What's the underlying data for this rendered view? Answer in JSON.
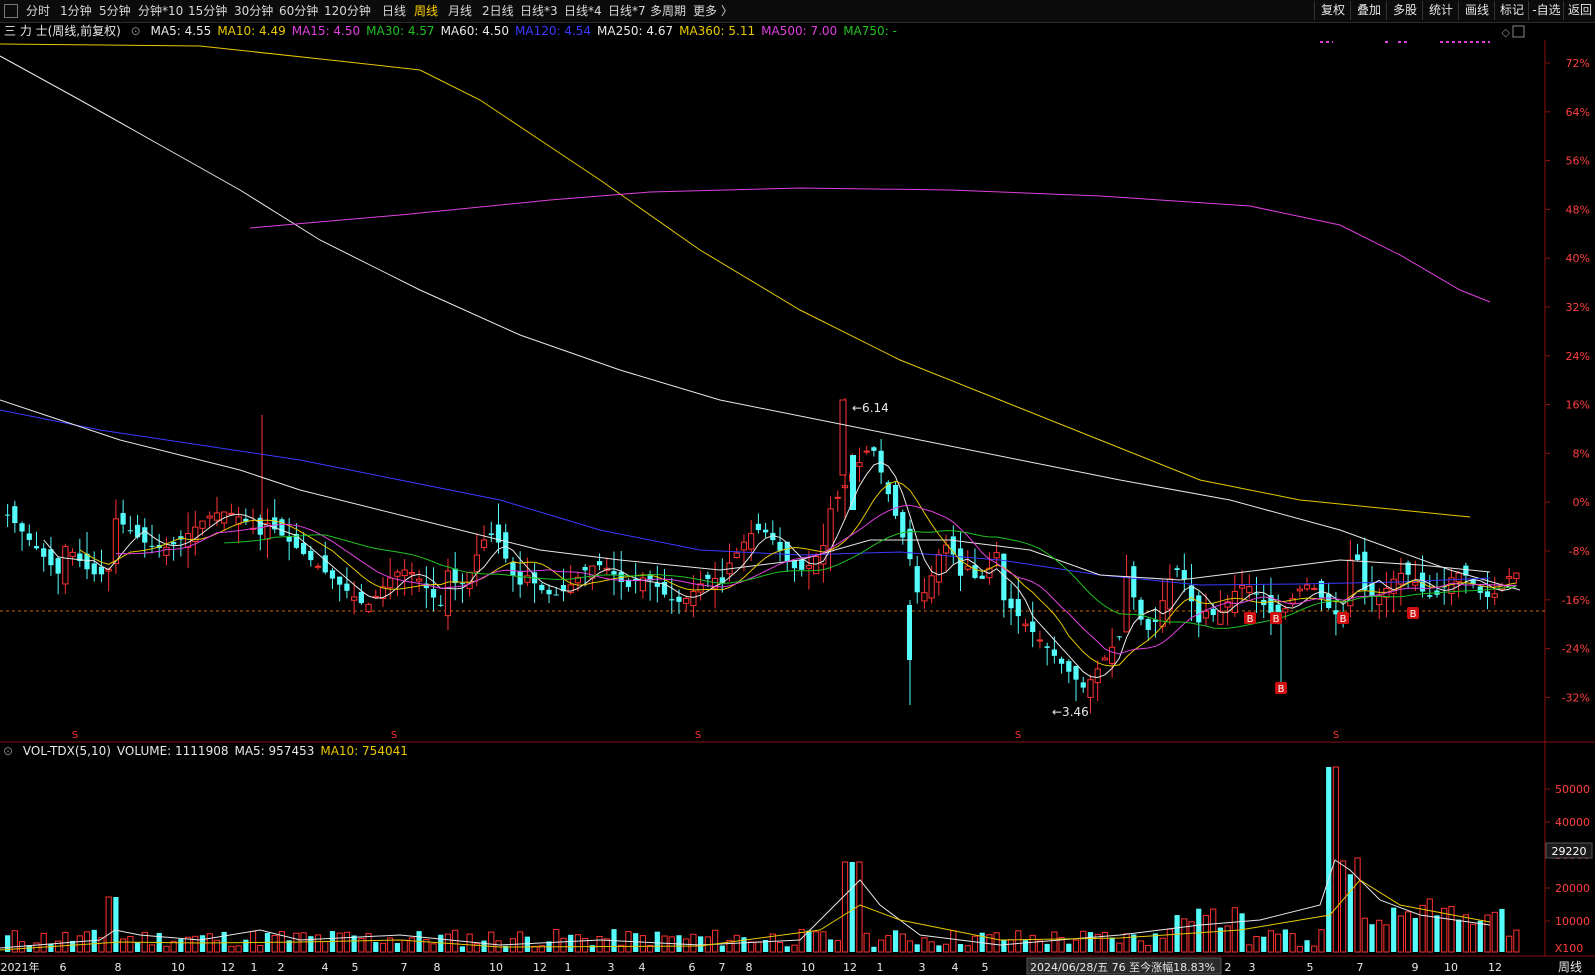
{
  "toolbar": {
    "periods": [
      "分时",
      "1分钟",
      "5分钟",
      "分钟*10",
      "15分钟",
      "30分钟",
      "60分钟",
      "120分钟",
      "日线",
      "周线",
      "月线",
      "2日线",
      "日线*3",
      "日线*4",
      "日线*7",
      "多周期",
      "更多 〉"
    ],
    "active": "周线",
    "right_buttons": [
      "复权",
      "叠加",
      "多股",
      "统计",
      "画线",
      "标记",
      "-自选",
      "返回"
    ]
  },
  "legend": {
    "title": "三 力 士(周线,前复权)",
    "items": [
      {
        "text": "MA5: 4.55",
        "color": "#e8e8e8"
      },
      {
        "text": "MA10: 4.49",
        "color": "#e8c800"
      },
      {
        "text": "MA15: 4.50",
        "color": "#e040e0"
      },
      {
        "text": "MA30: 4.57",
        "color": "#20c020"
      },
      {
        "text": "MA60: 4.50",
        "color": "#e8e8e8"
      },
      {
        "text": "MA120: 4.54",
        "color": "#3a3aff"
      },
      {
        "text": "MA250: 4.67",
        "color": "#e8e8e8"
      },
      {
        "text": "MA360: 5.11",
        "color": "#e8c800"
      },
      {
        "text": "MA500: 7.00",
        "color": "#e040e0"
      },
      {
        "text": "MA750: -",
        "color": "#20c020"
      }
    ]
  },
  "vol_legend": {
    "items": [
      {
        "text": "VOL-TDX(5,10)",
        "color": "#e8e8e8"
      },
      {
        "text": "VOLUME: 1111908",
        "color": "#e8e8e8"
      },
      {
        "text": "MA5: 957453",
        "color": "#e8e8e8"
      },
      {
        "text": "MA10: 754041",
        "color": "#e8c800"
      }
    ]
  },
  "chart_data": {
    "type": "candlestick",
    "price_axis_ticks": [
      "72%",
      "64%",
      "56%",
      "48%",
      "40%",
      "32%",
      "24%",
      "16%",
      "8%",
      "0%",
      "-8%",
      "-16%",
      "-24%",
      "-32%"
    ],
    "volume_axis_ticks": [
      "50000",
      "40000",
      "30000",
      "20000",
      "10000"
    ],
    "volume_highlight": "29220",
    "volume_unit": "X100",
    "max_label": "6.14",
    "min_label": "3.46",
    "x_axis_labels": [
      "2021年",
      "6",
      "8",
      "10",
      "12",
      "1",
      "2",
      "4",
      "5",
      "7",
      "8",
      "10",
      "12",
      "1",
      "3",
      "4",
      "6",
      "7",
      "8",
      "10",
      "12",
      "1",
      "3",
      "4",
      "5",
      "2024/06/28/五 76 至今涨幅18.83%",
      "2",
      "3",
      "5",
      "7",
      "9",
      "10",
      "12"
    ],
    "period_label": "周线",
    "signal_markers": [
      "B",
      "B",
      "B",
      "B",
      "B",
      "B"
    ],
    "s_markers": [
      "S",
      "S",
      "S",
      "S",
      "S"
    ],
    "colors": {
      "up": "#ff3232",
      "down": "#54fcfc",
      "ma5": "#e8e8e8",
      "ma10": "#e8c800",
      "ma15": "#e040e0",
      "ma30": "#20c020",
      "ma120": "#3a3aff",
      "ma250": "#e8e8e8",
      "ma360": "#e8c800",
      "ma500": "#e040e0"
    },
    "close_reference_percent": -13.5,
    "series": [
      {
        "name": "MA250",
        "points": [
          [
            0,
            56
          ],
          [
            80,
            100
          ],
          [
            160,
            145
          ],
          [
            240,
            190
          ],
          [
            320,
            240
          ],
          [
            420,
            290
          ],
          [
            520,
            335
          ],
          [
            620,
            370
          ],
          [
            720,
            400
          ],
          [
            820,
            420
          ],
          [
            920,
            440
          ],
          [
            1020,
            460
          ],
          [
            1120,
            480
          ],
          [
            1230,
            500
          ],
          [
            1340,
            530
          ],
          [
            1450,
            570
          ],
          [
            1520,
            590
          ]
        ]
      },
      {
        "name": "MA360",
        "points": [
          [
            0,
            44
          ],
          [
            200,
            46
          ],
          [
            330,
            60
          ],
          [
            420,
            70
          ],
          [
            480,
            100
          ],
          [
            540,
            140
          ],
          [
            600,
            180
          ],
          [
            700,
            250
          ],
          [
            800,
            310
          ],
          [
            900,
            360
          ],
          [
            1000,
            400
          ],
          [
            1100,
            440
          ],
          [
            1200,
            480
          ],
          [
            1300,
            500
          ],
          [
            1400,
            510
          ],
          [
            1470,
            517
          ]
        ]
      },
      {
        "name": "MA500",
        "points": [
          [
            250,
            228
          ],
          [
            400,
            215
          ],
          [
            550,
            200
          ],
          [
            650,
            192
          ],
          [
            800,
            188
          ],
          [
            950,
            190
          ],
          [
            1100,
            196
          ],
          [
            1250,
            206
          ],
          [
            1340,
            225
          ],
          [
            1400,
            255
          ],
          [
            1460,
            290
          ],
          [
            1490,
            302
          ]
        ]
      },
      {
        "name": "MA120",
        "points": [
          [
            0,
            410
          ],
          [
            100,
            430
          ],
          [
            200,
            445
          ],
          [
            300,
            460
          ],
          [
            400,
            480
          ],
          [
            500,
            500
          ],
          [
            600,
            530
          ],
          [
            700,
            550
          ],
          [
            800,
            555
          ],
          [
            900,
            552
          ],
          [
            1000,
            560
          ],
          [
            1100,
            575
          ],
          [
            1200,
            585
          ],
          [
            1300,
            584
          ],
          [
            1400,
            582
          ],
          [
            1490,
            578
          ]
        ]
      },
      {
        "name": "MA60",
        "points": [
          [
            0,
            400
          ],
          [
            60,
            420
          ],
          [
            120,
            440
          ],
          [
            180,
            455
          ],
          [
            240,
            470
          ],
          [
            300,
            490
          ],
          [
            380,
            510
          ],
          [
            460,
            530
          ],
          [
            540,
            550
          ],
          [
            620,
            560
          ],
          [
            720,
            570
          ],
          [
            800,
            560
          ],
          [
            870,
            540
          ],
          [
            950,
            540
          ],
          [
            1030,
            550
          ],
          [
            1100,
            575
          ],
          [
            1180,
            580
          ],
          [
            1260,
            570
          ],
          [
            1340,
            560
          ],
          [
            1420,
            565
          ],
          [
            1490,
            572
          ]
        ]
      }
    ]
  }
}
